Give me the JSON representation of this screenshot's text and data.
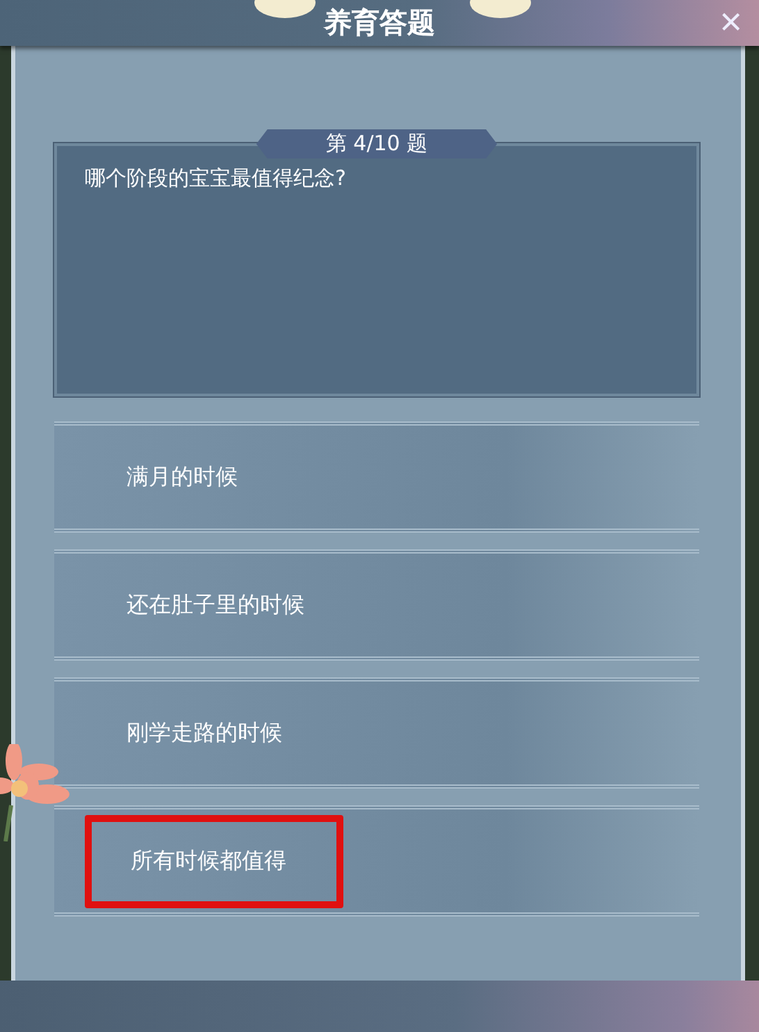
{
  "window": {
    "title": "养育答题",
    "close": "×"
  },
  "question": {
    "counter": "第 4/10 题",
    "text": "哪个阶段的宝宝最值得纪念?"
  },
  "options": [
    {
      "label": "满月的时候",
      "highlighted": false
    },
    {
      "label": "还在肚子里的时候",
      "highlighted": false
    },
    {
      "label": "刚学走路的时候",
      "highlighted": false
    },
    {
      "label": "所有时候都值得",
      "highlighted": true
    }
  ]
}
